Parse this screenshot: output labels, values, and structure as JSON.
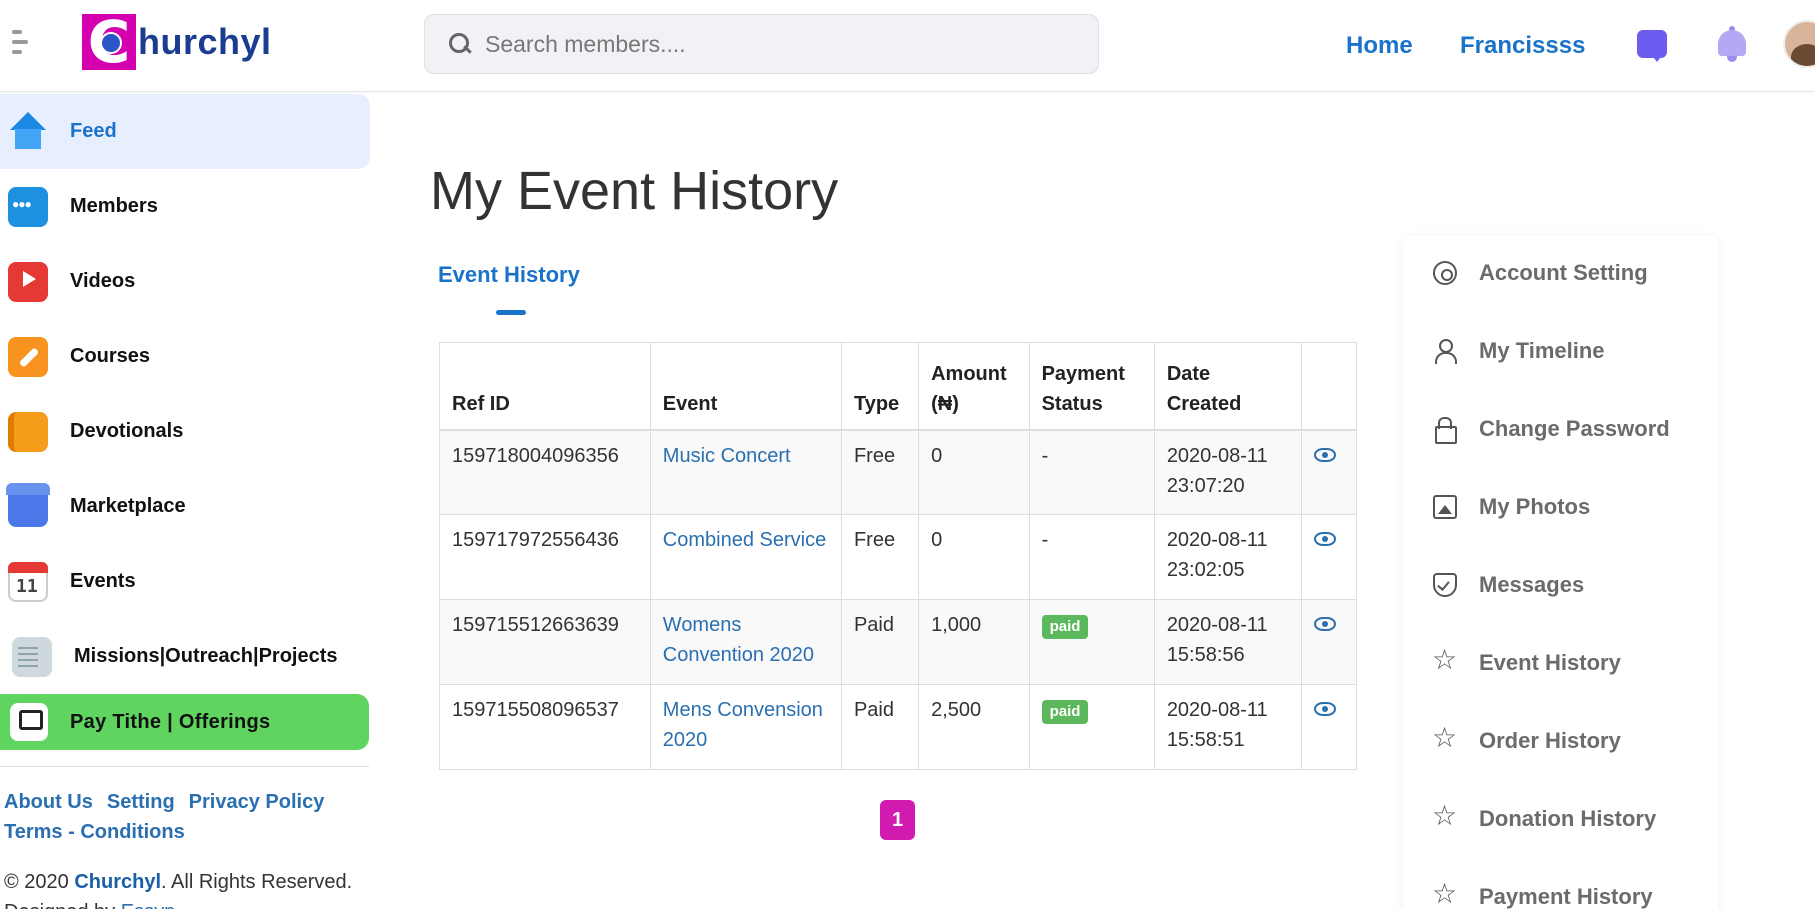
{
  "header": {
    "logo_text": "hurchyl",
    "logo_letter": "C",
    "search_placeholder": "Search members....",
    "nav": {
      "home": "Home",
      "user": "Francissss"
    }
  },
  "sidebar": {
    "items": [
      {
        "label": "Feed",
        "icon": "home-icon",
        "active": true
      },
      {
        "label": "Members",
        "icon": "members-icon"
      },
      {
        "label": "Videos",
        "icon": "videos-icon"
      },
      {
        "label": "Courses",
        "icon": "courses-icon"
      },
      {
        "label": "Devotionals",
        "icon": "devotionals-icon"
      },
      {
        "label": "Marketplace",
        "icon": "marketplace-icon"
      },
      {
        "label": "Events",
        "icon": "events-icon"
      },
      {
        "label": "Missions|Outreach|Projects",
        "icon": "missions-icon"
      }
    ],
    "tithe": {
      "label": "Pay Tithe | Offerings",
      "icon": "pay-icon"
    },
    "footer_links": [
      "About Us",
      "Setting",
      "Privacy Policy",
      "Terms - Conditions"
    ],
    "copyright": {
      "prefix": "© 2020 ",
      "brand": "Churchyl",
      "suffix": ". All Rights Reserved.",
      "designed_by": "Designed by ",
      "designer": "Essyp"
    }
  },
  "main": {
    "title": "My Event History",
    "tab": "Event History",
    "table": {
      "headers": [
        "Ref ID",
        "Event",
        "Type",
        "Amount (₦)",
        "Payment Status",
        "Date Created",
        ""
      ],
      "rows": [
        {
          "ref": "159718004096356",
          "event": "Music Concert",
          "type": "Free",
          "amount": "0",
          "status": "-",
          "date": "2020-08-11",
          "time": "23:07:20"
        },
        {
          "ref": "159717972556436",
          "event": "Combined Service",
          "type": "Free",
          "amount": "0",
          "status": "-",
          "date": "2020-08-11",
          "time": "23:02:05"
        },
        {
          "ref": "159715512663639",
          "event": "Womens Convention 2020",
          "type": "Paid",
          "amount": "1,000",
          "status": "paid",
          "date": "2020-08-11",
          "time": "15:58:56"
        },
        {
          "ref": "159715508096537",
          "event": "Mens Convension 2020",
          "type": "Paid",
          "amount": "2,500",
          "status": "paid",
          "date": "2020-08-11",
          "time": "15:58:51"
        }
      ]
    },
    "pagination": {
      "current": "1"
    }
  },
  "right_menu": {
    "items": [
      {
        "label": "Account Setting",
        "icon": "gear-icon"
      },
      {
        "label": "My Timeline",
        "icon": "user-icon"
      },
      {
        "label": "Change Password",
        "icon": "lock-icon"
      },
      {
        "label": "My Photos",
        "icon": "photo-icon"
      },
      {
        "label": "Messages",
        "icon": "shield-icon"
      },
      {
        "label": "Event History",
        "icon": "star-icon"
      },
      {
        "label": "Order History",
        "icon": "star-icon"
      },
      {
        "label": "Donation History",
        "icon": "star-icon"
      },
      {
        "label": "Payment History",
        "icon": "star-icon"
      }
    ]
  },
  "colors": {
    "brand": "#d400b0",
    "link": "#1a73c9",
    "paid": "#5cb85c",
    "tithe": "#5fd55f"
  }
}
